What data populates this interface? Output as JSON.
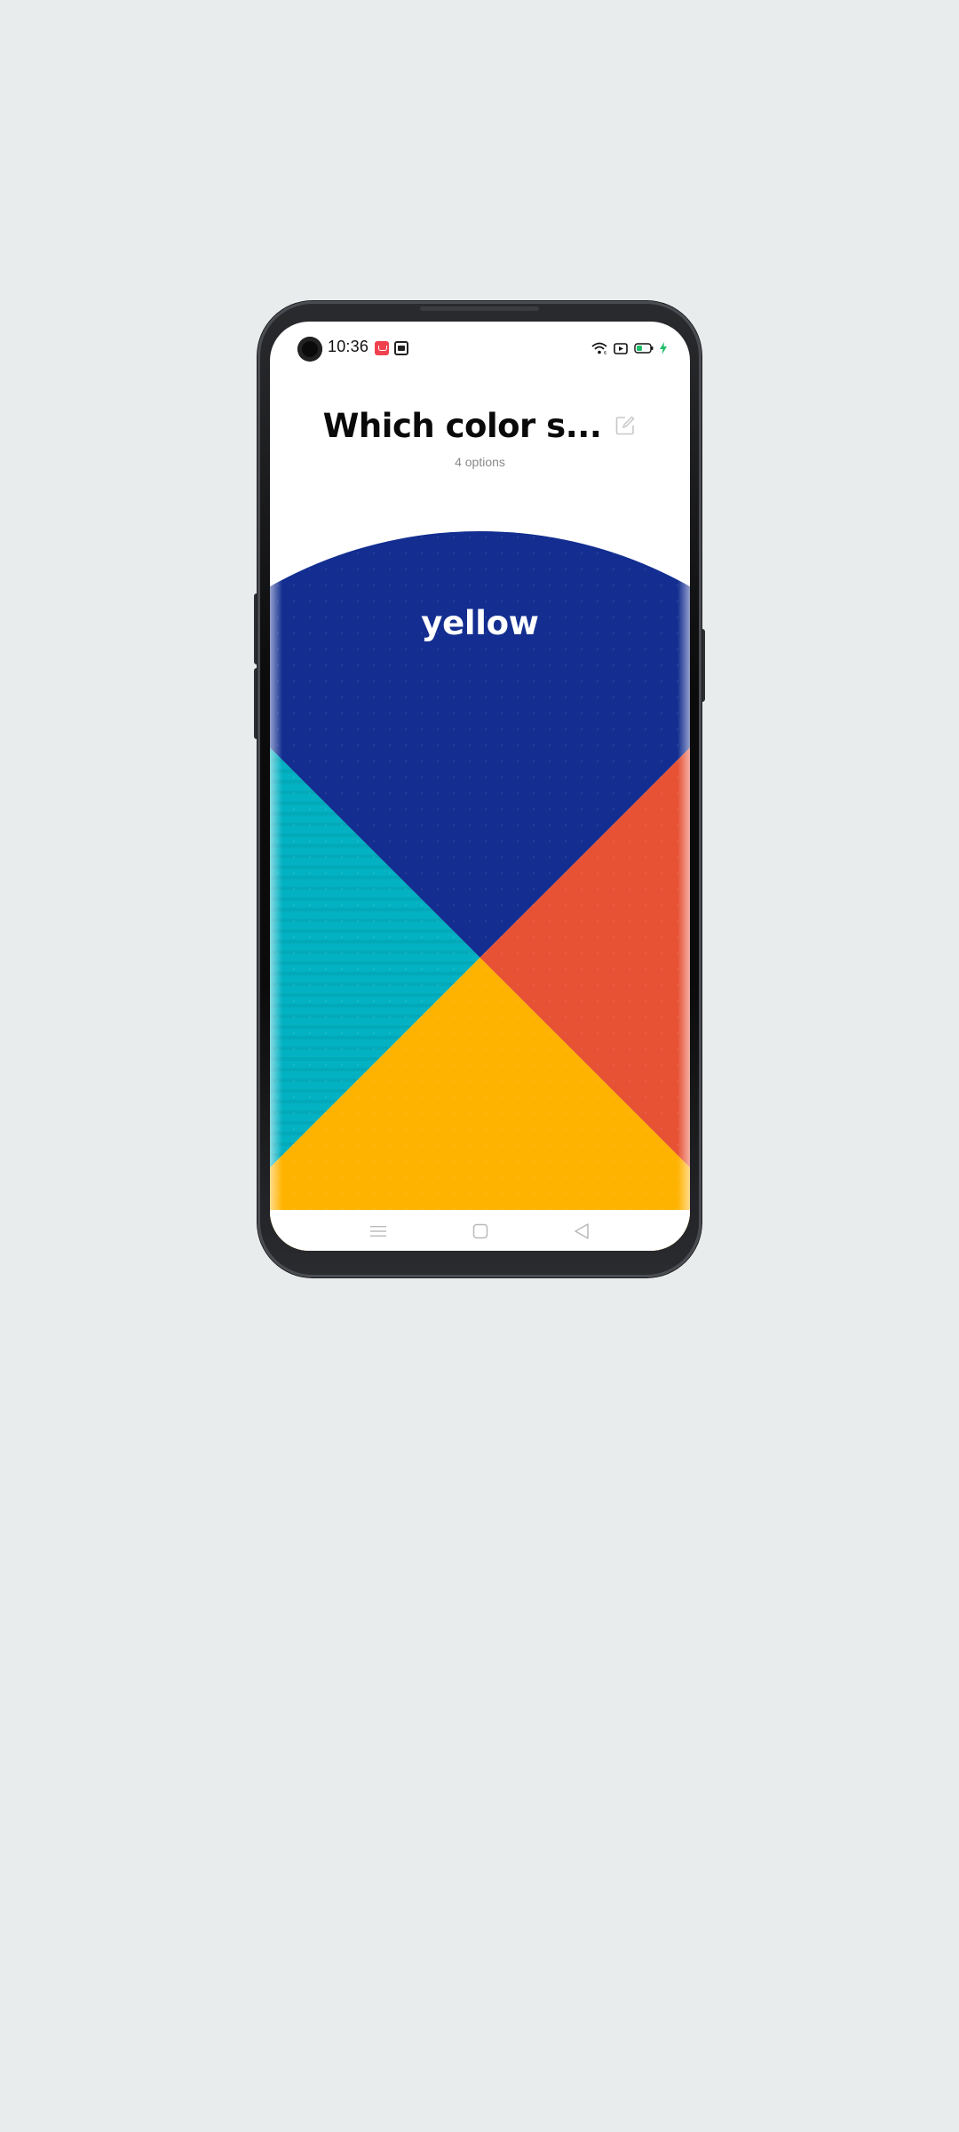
{
  "status_bar": {
    "time": "10:36",
    "icons": [
      "camera-icon",
      "notification-app-icon",
      "notification-gallery-icon",
      "wifi-icon",
      "cast-icon",
      "battery-icon",
      "charging-icon"
    ]
  },
  "header": {
    "title": "Which color s...",
    "subtitle": "4 options",
    "edit_icon": "edit-icon"
  },
  "wheel": {
    "selected_label": "yellow",
    "segments": [
      {
        "name": "top",
        "color": "#132e90"
      },
      {
        "name": "left",
        "color": "#02b2c3"
      },
      {
        "name": "right",
        "color": "#e75134"
      },
      {
        "name": "bottom",
        "color": "#ffb301"
      }
    ]
  },
  "nav_bar": {
    "icons": [
      "menu-icon",
      "home-icon",
      "back-icon"
    ]
  },
  "colors": {
    "background": "#e9eced",
    "screen": "#ffffff",
    "phone_frame": "#111214"
  }
}
